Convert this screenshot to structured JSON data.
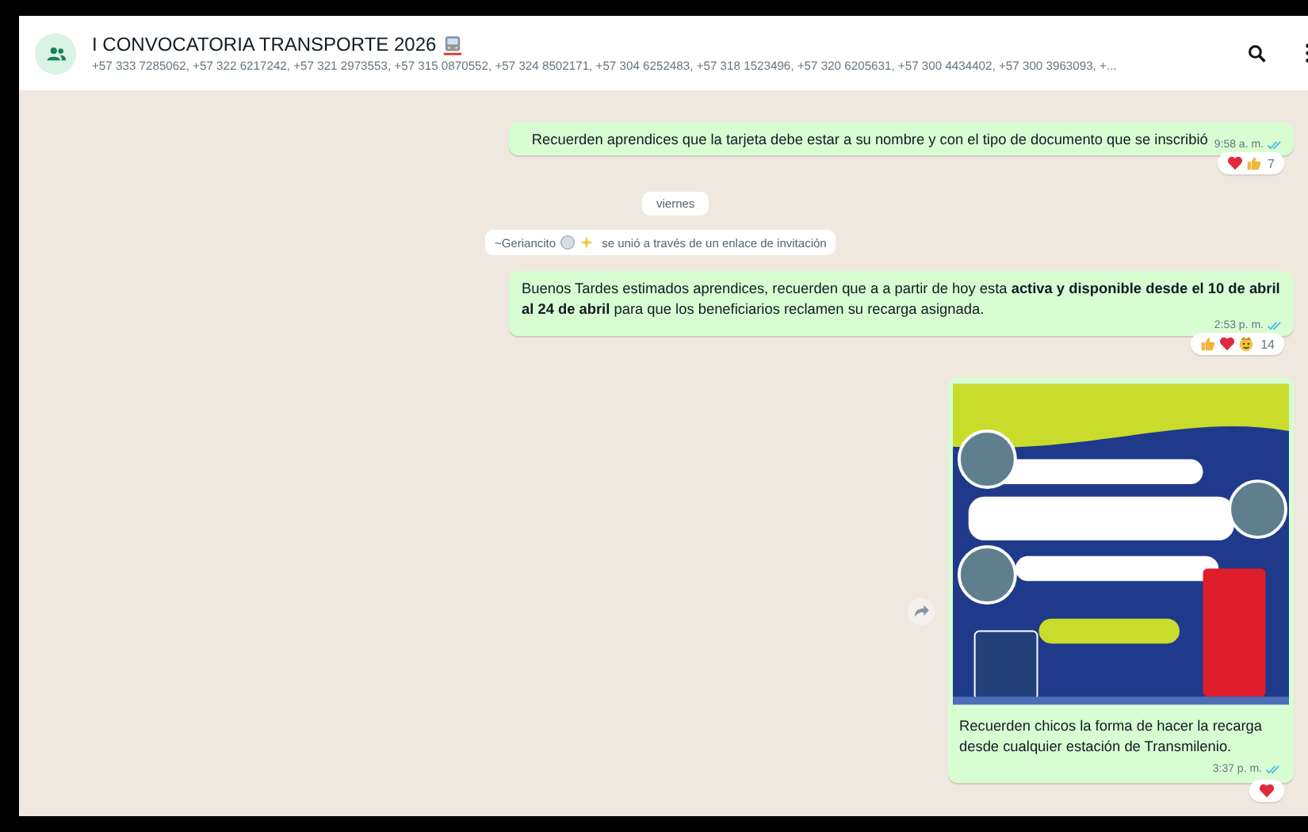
{
  "header": {
    "title": "I CONVOCATORIA TRANSPORTE 2026",
    "participants": "+57 333 7285062, +57 322 6217242, +57 321 2973553, +57 315 0870552, +57 324 8502171, +57 304 6252483, +57 318 1523496, +57 320 6205631, +57 300 4434402, +57 300 3963093, +..."
  },
  "messages": [
    {
      "kind": "outgoing",
      "text": "Recuerden aprendices que la tarjeta debe estar a su nombre y con el tipo de documento que se inscribió",
      "time": "9:58 a. m.",
      "read": true,
      "reactions": [
        {
          "kind": "heart"
        },
        {
          "kind": "thumbs_up"
        }
      ],
      "reaction_count": "7"
    },
    {
      "kind": "date",
      "text": "viernes"
    },
    {
      "kind": "system",
      "name": "~Geriancito",
      "text": "se unió a través de un enlace de invitación"
    },
    {
      "kind": "outgoing",
      "text": "Buenos Tardes estimados aprendices,  recuerden que a a partir de hoy esta **activa y disponible desde el 10 de abril al 24 de abril** para que los beneficiarios reclamen su recarga asignada.",
      "time": "2:53 p. m.",
      "read": true,
      "reactions": [
        {
          "kind": "thumbs_up"
        },
        {
          "kind": "heart"
        },
        {
          "kind": "face"
        }
      ],
      "reaction_count": "14"
    },
    {
      "kind": "image",
      "text": "Recuerden chicos la forma de hacer la recarga desde cualquier estación de Transmilenio.",
      "time": "3:37 p. m.",
      "read": true,
      "reactions": [
        {
          "kind": "heart"
        }
      ]
    }
  ]
}
